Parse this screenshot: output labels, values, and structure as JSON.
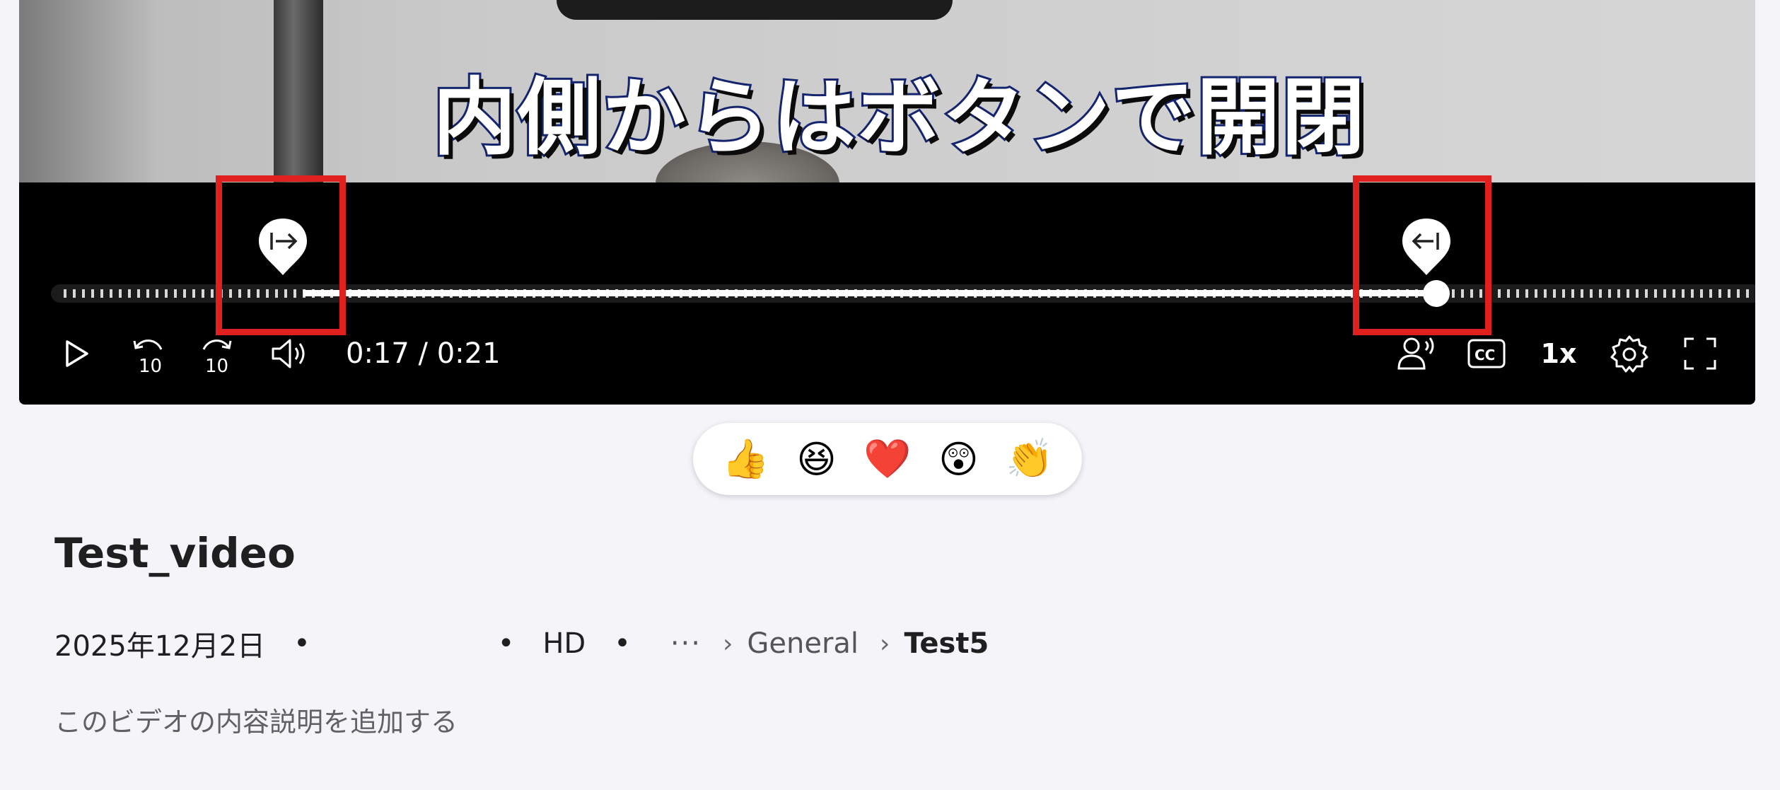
{
  "video": {
    "caption": "内側からはボタンで開閉",
    "time_current": "0:17",
    "time_total": "0:21",
    "time_display": "0:17 / 0:21",
    "progress_fraction": 0.81,
    "trim_start_fraction": 0.149,
    "trim_end_fraction": 0.81,
    "speed": "1x",
    "skip_back_label": "10",
    "skip_forward_label": "10"
  },
  "icons": {
    "play": "play-icon",
    "skip_back": "rewind-10-icon",
    "skip_forward": "forward-10-icon",
    "volume": "volume-icon",
    "speaker_view": "speaker-icon",
    "captions": "closed-captions-icon",
    "settings": "gear-icon",
    "fullscreen": "fullscreen-icon",
    "trim_start": "trim-start-icon",
    "trim_end": "trim-end-icon"
  },
  "highlight_color": "#e01f1f",
  "reactions": [
    "👍",
    "😆",
    "❤️",
    "😲",
    "👏"
  ],
  "info": {
    "title": "Test_video",
    "date": "2025年12月2日",
    "bullet": "•",
    "quality": "HD",
    "more": "···",
    "chevron": "›",
    "breadcrumb_parent": "General",
    "breadcrumb_current": "Test5",
    "description_placeholder": "このビデオの内容説明を追加する"
  }
}
